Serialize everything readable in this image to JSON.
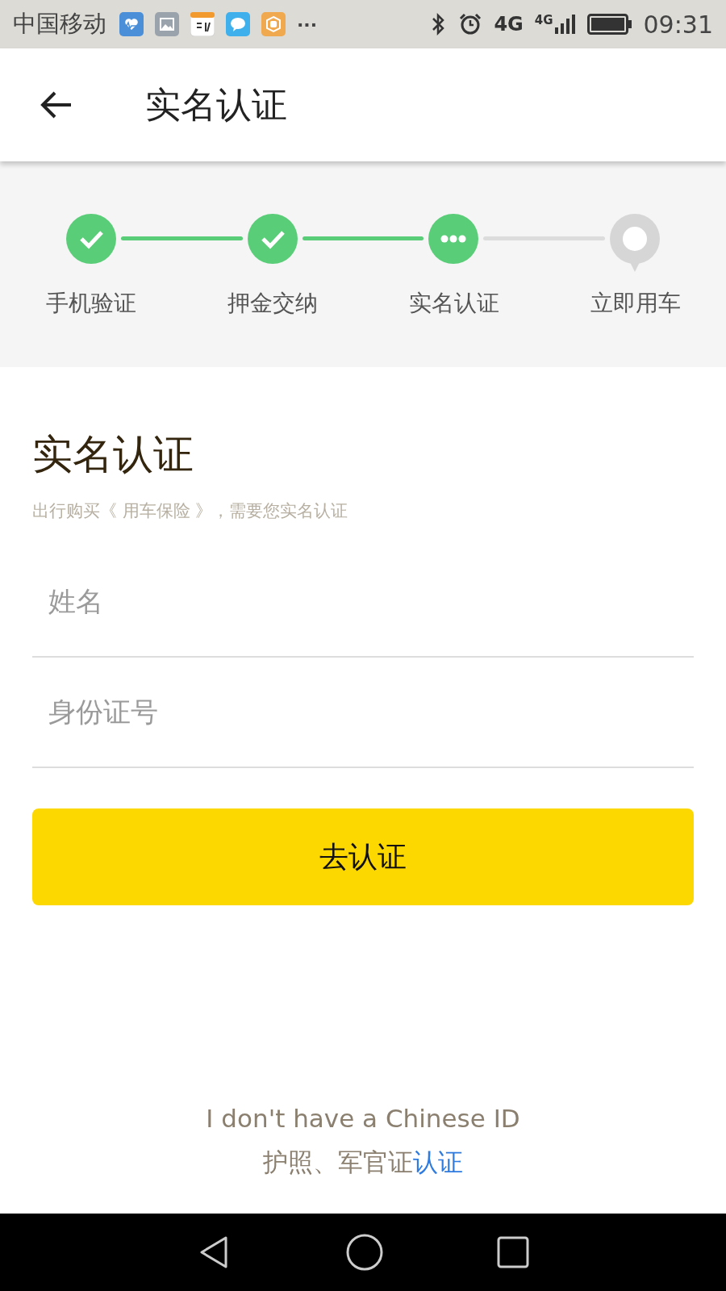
{
  "status_bar": {
    "carrier": "中国移动",
    "more": "···",
    "network_labels": [
      "4G",
      "4G"
    ],
    "time": "09:31"
  },
  "app_bar": {
    "title": "实名认证"
  },
  "steps": [
    {
      "label": "手机验证",
      "kind": "done"
    },
    {
      "label": "押金交纳",
      "kind": "done"
    },
    {
      "label": "实名认证",
      "kind": "current"
    },
    {
      "label": "立即用车",
      "kind": "pending"
    }
  ],
  "form": {
    "title": "实名认证",
    "subtitle": "出行购买《 用车保险 》，需要您实名认证",
    "fields": [
      {
        "placeholder": "姓名"
      },
      {
        "placeholder": "身份证号"
      }
    ],
    "submit": "去认证"
  },
  "footer": {
    "note": "I don't have a Chinese ID",
    "alt_text": "护照、军官证",
    "alt_link": "认证"
  }
}
